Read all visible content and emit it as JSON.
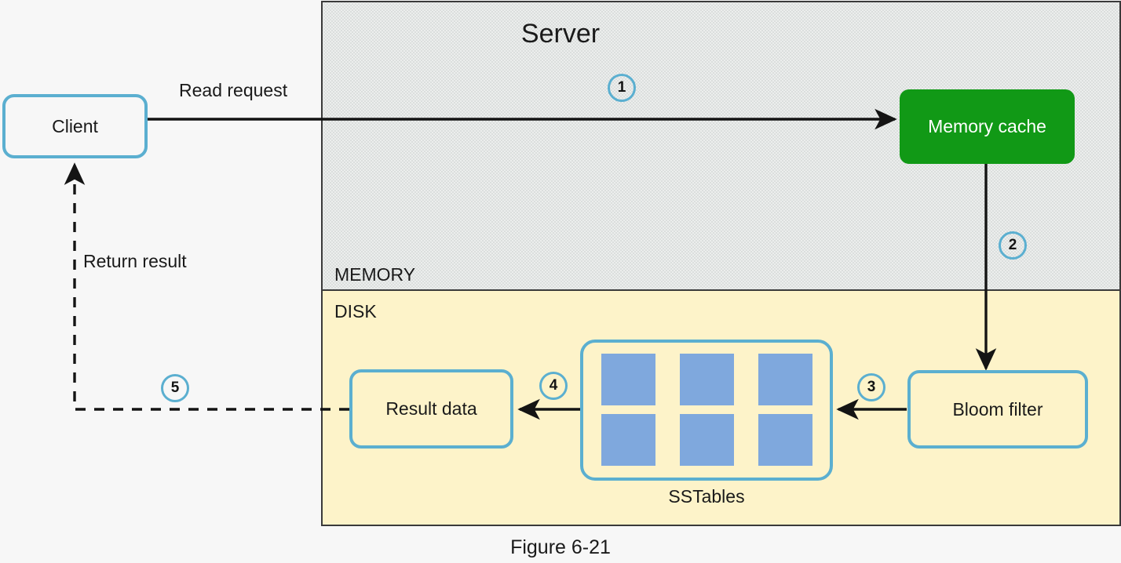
{
  "figure": {
    "caption": "Figure 6-21",
    "title": "Server"
  },
  "regions": [
    {
      "id": "memory",
      "label": "MEMORY",
      "fill": "#eceeed"
    },
    {
      "id": "disk",
      "label": "DISK",
      "fill": "#fdf3c9"
    }
  ],
  "nodes": {
    "client": {
      "label": "Client",
      "fill": "#f7f7f7",
      "stroke": "#5bafd0"
    },
    "memory_cache": {
      "label": "Memory cache",
      "fill": "#119916",
      "stroke": "#119916",
      "text_color": "#ffffff"
    },
    "bloom_filter": {
      "label": "Bloom filter",
      "fill": "transparent",
      "stroke": "#5bafd0"
    },
    "sstables": {
      "label": "SSTables",
      "fill": "transparent",
      "stroke": "#5bafd0",
      "tile_color": "#7fa8dd",
      "tile_rows": 2,
      "tile_cols": 3
    },
    "result_data": {
      "label": "Result data",
      "fill": "transparent",
      "stroke": "#5bafd0"
    }
  },
  "edges": [
    {
      "id": "1",
      "label": "Read request",
      "step": "1",
      "style": "solid"
    },
    {
      "id": "2",
      "label": "",
      "step": "2",
      "style": "solid"
    },
    {
      "id": "3",
      "label": "",
      "step": "3",
      "style": "solid"
    },
    {
      "id": "4",
      "label": "",
      "step": "4",
      "style": "solid"
    },
    {
      "id": "5",
      "label": "Return result",
      "step": "5",
      "style": "dashed"
    }
  ],
  "colors": {
    "accent_blue": "#5bafd0",
    "green": "#119916",
    "tile_blue": "#7fa8dd",
    "memory_bg": "#eceeed",
    "disk_bg": "#fdf3c9",
    "page_bg": "#f7f7f7",
    "line": "#1a1a1a"
  }
}
